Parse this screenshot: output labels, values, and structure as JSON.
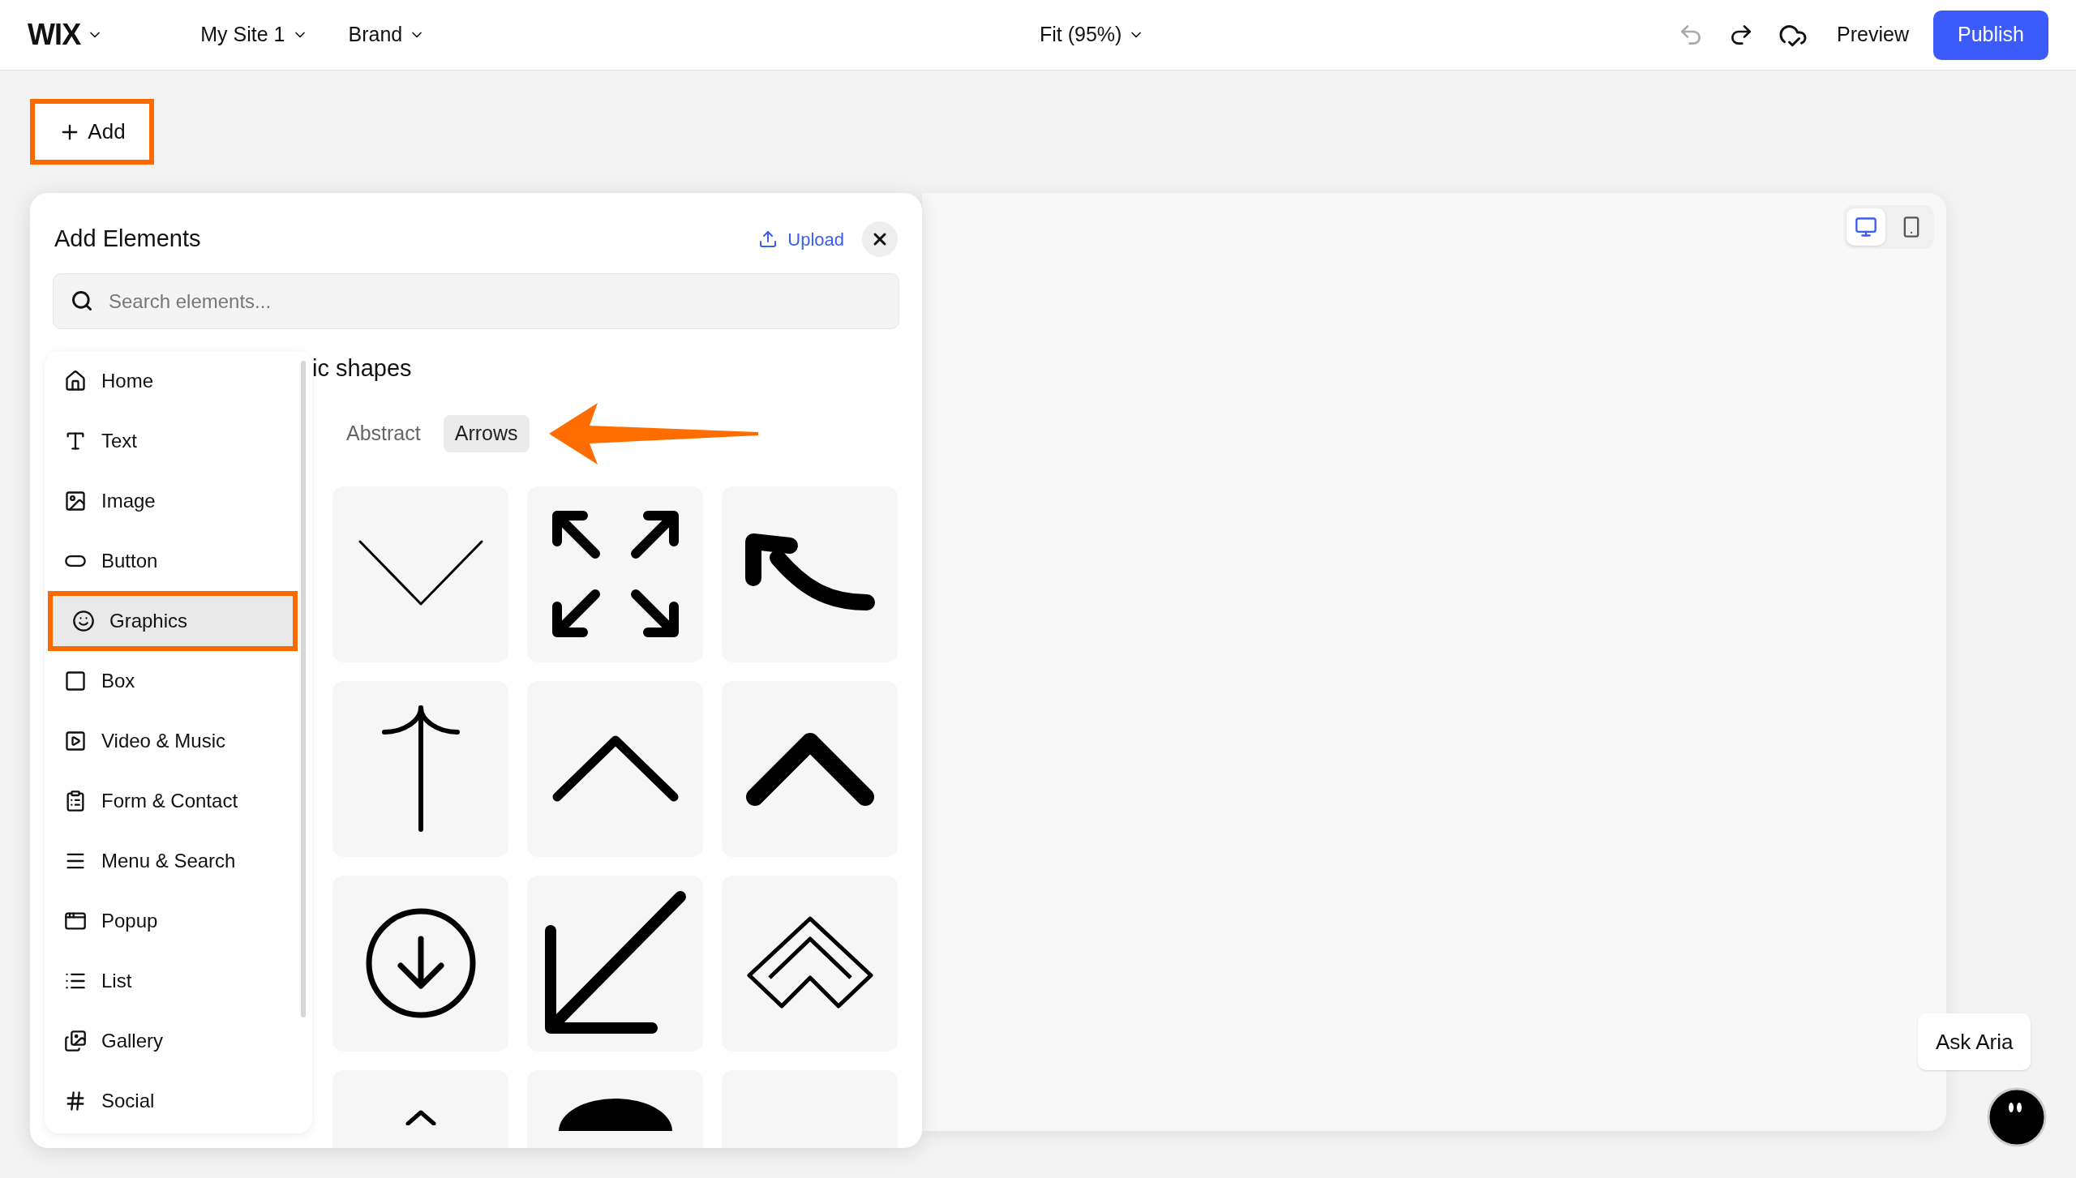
{
  "topbar": {
    "logo": "WIX",
    "site": "My Site 1",
    "brand": "Brand",
    "zoom": "Fit (95%)",
    "preview": "Preview",
    "publish": "Publish"
  },
  "add_button": {
    "label": "Add",
    "highlighted": true
  },
  "panel": {
    "title": "Add Elements",
    "upload": "Upload",
    "search": {
      "placeholder": "Search elements..."
    },
    "nav": [
      {
        "kind": "home",
        "label": "Home",
        "selected": false,
        "highlighted": false
      },
      {
        "kind": "text",
        "label": "Text",
        "selected": false,
        "highlighted": false
      },
      {
        "kind": "image",
        "label": "Image",
        "selected": false,
        "highlighted": false
      },
      {
        "kind": "button",
        "label": "Button",
        "selected": false,
        "highlighted": false
      },
      {
        "kind": "graphics",
        "label": "Graphics",
        "selected": true,
        "highlighted": true
      },
      {
        "kind": "box",
        "label": "Box",
        "selected": false,
        "highlighted": false
      },
      {
        "kind": "video",
        "label": "Video & Music",
        "selected": false,
        "highlighted": false
      },
      {
        "kind": "form",
        "label": "Form & Contact",
        "selected": false,
        "highlighted": false
      },
      {
        "kind": "menu",
        "label": "Menu & Search",
        "selected": false,
        "highlighted": false
      },
      {
        "kind": "popup",
        "label": "Popup",
        "selected": false,
        "highlighted": false
      },
      {
        "kind": "list",
        "label": "List",
        "selected": false,
        "highlighted": false
      },
      {
        "kind": "gallery",
        "label": "Gallery",
        "selected": false,
        "highlighted": false
      },
      {
        "kind": "social",
        "label": "Social",
        "selected": false,
        "highlighted": false
      }
    ],
    "section_title": "ic shapes",
    "filters": [
      {
        "label": "Abstract",
        "selected": false
      },
      {
        "label": "Arrows",
        "selected": true
      }
    ],
    "shapes": [
      {
        "kind": "chevron-down"
      },
      {
        "kind": "expand"
      },
      {
        "kind": "curved-arrow"
      },
      {
        "kind": "thin-up-arrow"
      },
      {
        "kind": "caret-up"
      },
      {
        "kind": "bold-caret-up"
      },
      {
        "kind": "circle-down"
      },
      {
        "kind": "arrow-down-left"
      },
      {
        "kind": "double-chevron-up"
      },
      {
        "kind": "small-caret"
      },
      {
        "kind": "half-circle"
      },
      {
        "kind": "blank"
      }
    ]
  },
  "canvas": {
    "views": [
      {
        "kind": "desktop",
        "selected": true
      },
      {
        "kind": "mobile",
        "selected": false
      }
    ]
  },
  "assistant": {
    "label": "Ask Aria"
  }
}
